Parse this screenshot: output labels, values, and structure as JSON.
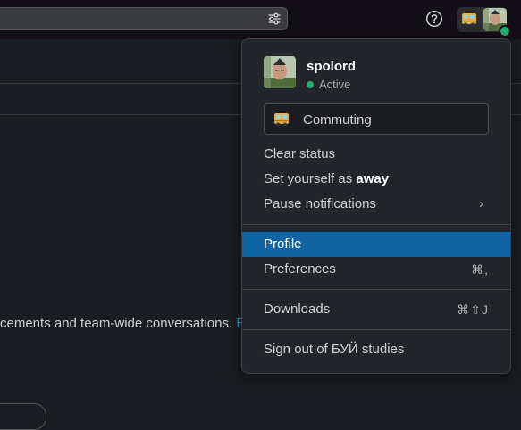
{
  "topbar": {
    "search_icon": "sliders-icon",
    "help_icon": "help-circle-icon",
    "status_emoji": "bus-emoji",
    "accent_color": "#2bac76"
  },
  "background": {
    "text": "cements and team-wide conversations.",
    "link": "Ed"
  },
  "menu": {
    "username": "spolord",
    "presence": "Active",
    "status_text": "Commuting",
    "clear_status": "Clear status",
    "set_away_prefix": "Set yourself as ",
    "set_away_bold": "away",
    "pause_notifications": "Pause notifications",
    "pause_chevron": "›",
    "profile": "Profile",
    "preferences": "Preferences",
    "preferences_shortcut": "⌘,",
    "downloads": "Downloads",
    "downloads_shortcut": "⌘⇧J",
    "sign_out": "Sign out of БУЙ studies",
    "highlight_color": "#1164a3"
  }
}
